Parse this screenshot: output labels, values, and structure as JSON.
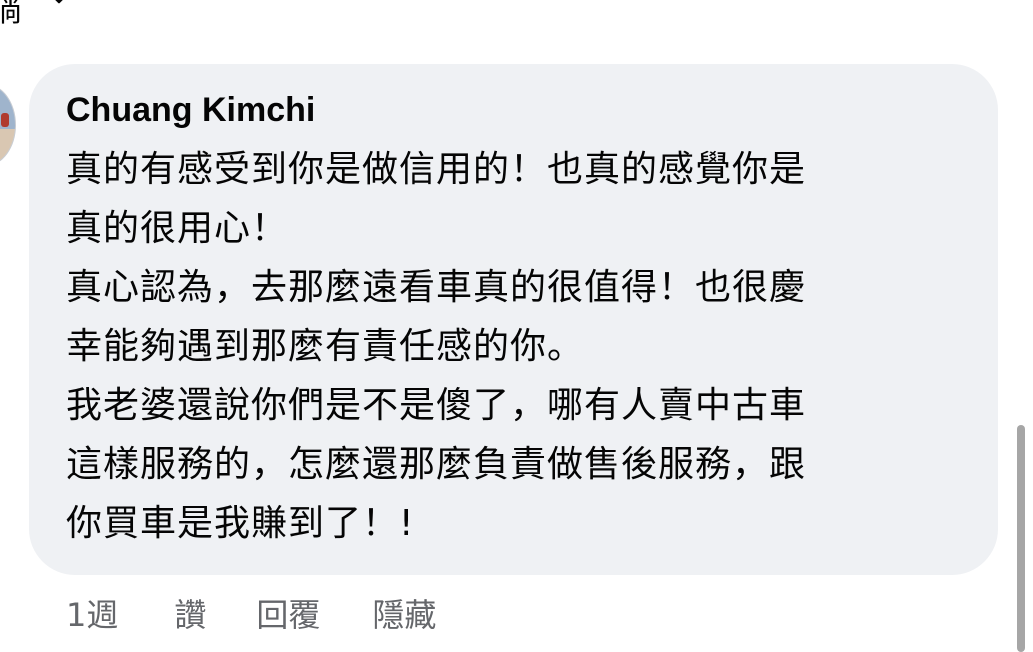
{
  "top": {
    "fragment_text": "倘"
  },
  "comment": {
    "author": "Chuang Kimchi",
    "lines": [
      "真的有感受到你是做信用的！也真的感覺你是",
      "真的很用心！",
      "真心認為，去那麼遠看車真的很值得！也很慶",
      "幸能夠遇到那麼有責任感的你。",
      "我老婆還說你們是不是傻了，哪有人賣中古車",
      "這樣服務的，怎麼還那麼負責做售後服務，跟",
      "你買車是我賺到了！!"
    ]
  },
  "actions": {
    "time": "1週",
    "like": "讚",
    "reply": "回覆",
    "hide": "隱藏"
  },
  "colors": {
    "bubble_bg": "#eff1f4",
    "text": "#050505",
    "secondary_text": "#65676b"
  },
  "icons": {
    "chevron": "chevron-down-icon",
    "avatar": "profile-avatar"
  }
}
